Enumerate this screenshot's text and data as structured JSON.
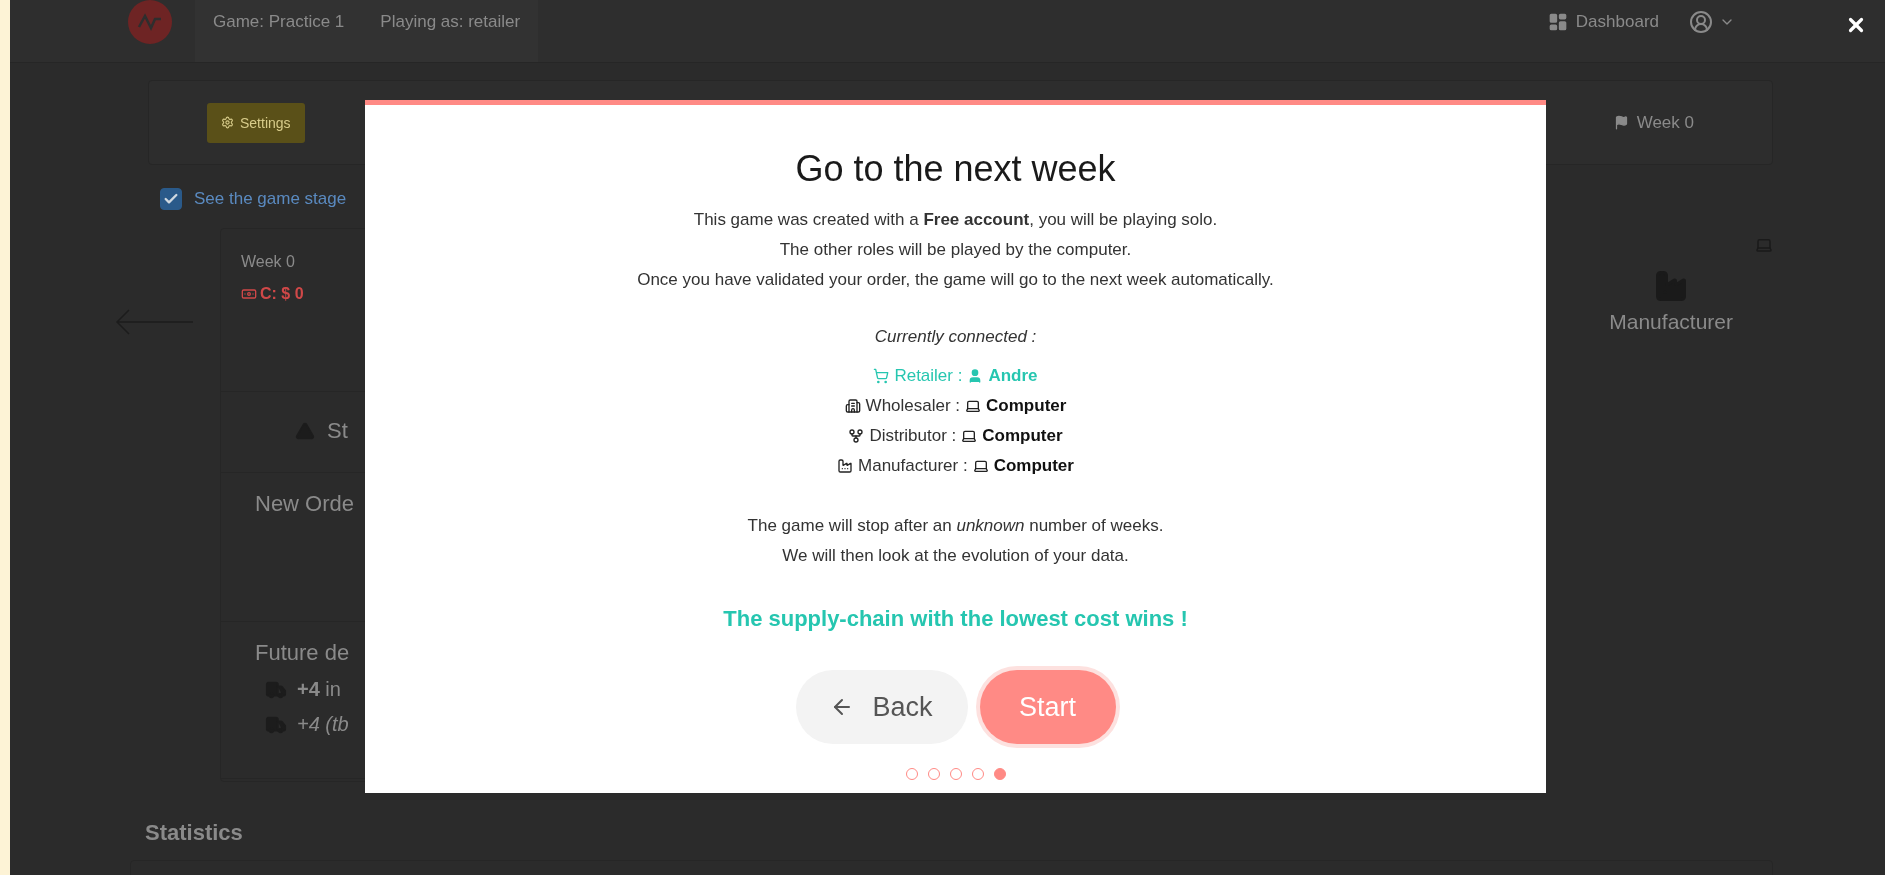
{
  "header": {
    "tabs": [
      {
        "label": "Game: Practice 1"
      },
      {
        "label": "Playing as: retailer"
      }
    ],
    "dashboard": "Dashboard"
  },
  "toolbar": {
    "settings": "Settings",
    "week": "Week 0"
  },
  "stage_toggle": {
    "label": "See the game stage",
    "checked": true
  },
  "player_card": {
    "week": "Week 0",
    "cost": "C: $ 0",
    "stock": "St",
    "new_order": "New Orde",
    "future": "Future de",
    "deliveries": [
      {
        "kind": "confirmed",
        "text": "**+4** in"
      },
      {
        "kind": "estimate",
        "text": "+4 (tb"
      }
    ]
  },
  "neighbor": {
    "role": "Manufacturer"
  },
  "statistics": "Statistics",
  "modal": {
    "title": "Go to the next week",
    "intro": [
      "This game was created with a **Free account**, you will be playing solo.",
      "The other roles will be played by the computer.",
      "Once you have validated your order, the game will go to the next week automatically."
    ],
    "connected_label": "Currently connected :",
    "roles": [
      {
        "kind": "retailer",
        "label": "Retailer :",
        "player": "Andre",
        "is_you": true
      },
      {
        "kind": "wholesaler",
        "label": "Wholesaler :",
        "player": "Computer",
        "is_you": false
      },
      {
        "kind": "distributor",
        "label": "Distributor :",
        "player": "Computer",
        "is_you": false
      },
      {
        "kind": "manufacturer",
        "label": "Manufacturer :",
        "player": "Computer",
        "is_you": false
      }
    ],
    "outro": [
      "The game will stop after an *unknown* number of weeks.",
      "We will then look at the evolution of your data."
    ],
    "headline": "The supply-chain with the lowest cost wins !",
    "back": "Back",
    "start": "Start",
    "steps": [
      {
        "selected": false
      },
      {
        "selected": false
      },
      {
        "selected": false
      },
      {
        "selected": false
      },
      {
        "selected": true
      }
    ]
  }
}
